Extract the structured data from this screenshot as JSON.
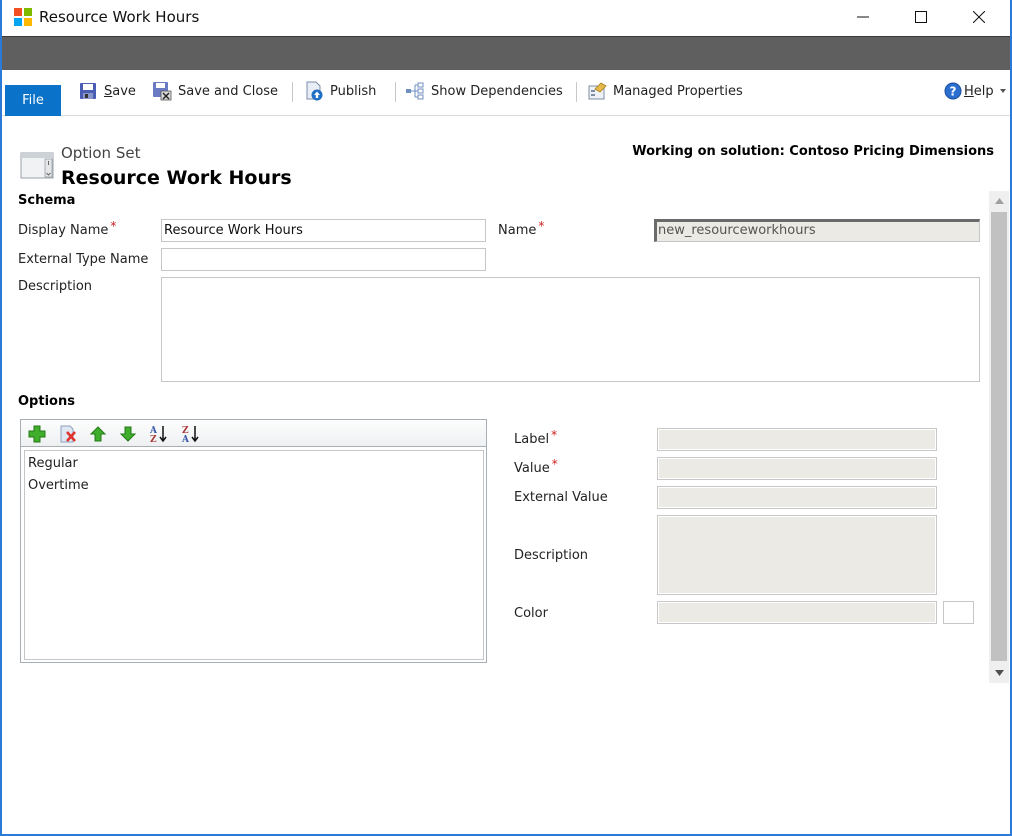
{
  "window": {
    "title": "Resource Work Hours",
    "controls": {
      "minimize": "minimize",
      "maximize": "maximize",
      "close": "close"
    }
  },
  "ribbon": {
    "file_tab": "File",
    "buttons": [
      {
        "id": "save",
        "label_accel": "S",
        "label_rest": "ave",
        "icon": "save-icon"
      },
      {
        "id": "save-and-close",
        "label": "Save and Close",
        "icon": "save-close-icon"
      },
      {
        "id": "publish",
        "label": "Publish",
        "icon": "publish-icon"
      },
      {
        "id": "show-dependencies",
        "label": "Show Dependencies",
        "icon": "dependencies-icon"
      },
      {
        "id": "managed-properties",
        "label": "Managed Properties",
        "icon": "managed-properties-icon"
      }
    ],
    "help": {
      "accel": "H",
      "rest": "elp",
      "icon": "help-icon"
    }
  },
  "header": {
    "entity_type": "Option Set",
    "entity_name": "Resource Work Hours",
    "solution": "Working on solution: Contoso Pricing Dimensions"
  },
  "schema": {
    "title": "Schema",
    "display_name": {
      "label": "Display Name",
      "required": "*",
      "value": "Resource Work Hours"
    },
    "name": {
      "label": "Name",
      "required": "*",
      "value": "new_resourceworkhours"
    },
    "external_type_name": {
      "label": "External Type Name",
      "value": ""
    },
    "description": {
      "label": "Description",
      "value": ""
    }
  },
  "options": {
    "title": "Options",
    "toolbar": [
      {
        "id": "add",
        "icon": "add-icon",
        "tooltip": "Add"
      },
      {
        "id": "delete",
        "icon": "delete-icon",
        "tooltip": "Delete"
      },
      {
        "id": "move-up",
        "icon": "arrow-up-icon",
        "tooltip": "Move Up"
      },
      {
        "id": "move-down",
        "icon": "arrow-down-icon",
        "tooltip": "Move Down"
      },
      {
        "id": "sort-asc",
        "icon": "sort-az-icon",
        "tooltip": "Sort A-Z"
      },
      {
        "id": "sort-desc",
        "icon": "sort-za-icon",
        "tooltip": "Sort Z-A"
      }
    ],
    "items": [
      "Regular",
      "Overtime"
    ],
    "detail": {
      "label": {
        "label": "Label",
        "required": "*",
        "value": ""
      },
      "value": {
        "label": "Value",
        "required": "*",
        "value": ""
      },
      "external_value": {
        "label": "External Value",
        "value": ""
      },
      "description": {
        "label": "Description",
        "value": ""
      },
      "color": {
        "label": "Color",
        "value": ""
      }
    }
  },
  "colors": {
    "file_tab": "#0a72c9",
    "dark_bar": "#5f5f5f",
    "required": "#d01c1c",
    "disabled_field": "#ebeae4",
    "window_border": "#2b7ad6"
  }
}
